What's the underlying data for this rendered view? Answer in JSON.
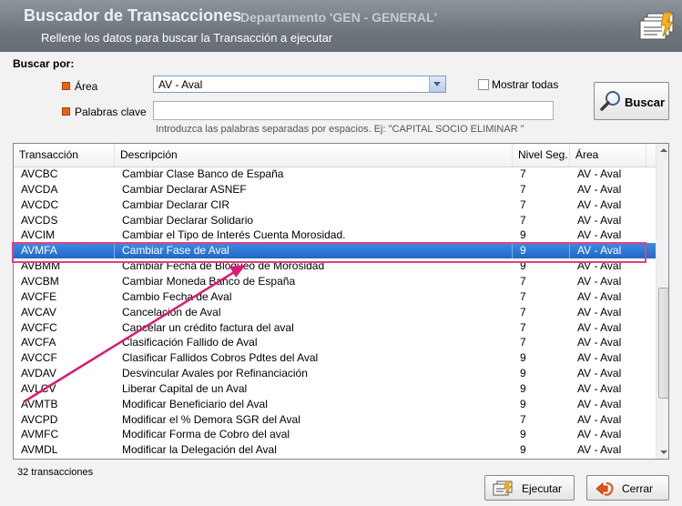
{
  "header": {
    "title": "Buscador de Transacciones",
    "department": "Departamento 'GEN - GENERAL'",
    "subtitle": "Rellene los datos para buscar la Transacción a ejecutar"
  },
  "search": {
    "section_label": "Buscar por:",
    "area_label": "Área",
    "area_value": "AV - Aval",
    "show_all_label": "Mostrar todas",
    "show_all_checked": false,
    "keywords_label": "Palabras clave",
    "keywords_value": "",
    "keywords_hint": "Introduzca las palabras separadas por espacios. Ej: \"CAPITAL SOCIO ELIMINAR \"",
    "search_button": "Buscar"
  },
  "table": {
    "columns": [
      "Transacción",
      "Descripción",
      "Nivel Seg.",
      "Área"
    ],
    "selected_index": 5,
    "rows": [
      [
        "AVCBC",
        "Cambiar Clase Banco de España",
        "7",
        "AV - Aval"
      ],
      [
        "AVCDA",
        "Cambiar Declarar ASNEF",
        "7",
        "AV - Aval"
      ],
      [
        "AVCDC",
        "Cambiar Declarar CIR",
        "7",
        "AV - Aval"
      ],
      [
        "AVCDS",
        "Cambiar Declarar Solidario",
        "7",
        "AV - Aval"
      ],
      [
        "AVCIM",
        "Cambiar el Tipo de Interés Cuenta Morosidad.",
        "9",
        "AV - Aval"
      ],
      [
        "AVMFA",
        "Cambiar Fase de Aval",
        "9",
        "AV - Aval"
      ],
      [
        "AVBMM",
        "Cambiar Fecha de Bloqueo de Morosidad",
        "9",
        "AV - Aval"
      ],
      [
        "AVCBM",
        "Cambiar Moneda Banco de España",
        "7",
        "AV - Aval"
      ],
      [
        "AVCFE",
        "Cambio Fecha de Aval",
        "7",
        "AV - Aval"
      ],
      [
        "AVCAV",
        "Cancelación de Aval",
        "7",
        "AV - Aval"
      ],
      [
        "AVCFC",
        "Cancelar un crédito factura del aval",
        "7",
        "AV - Aval"
      ],
      [
        "AVCFA",
        "Clasificación Fallido de Aval",
        "7",
        "AV - Aval"
      ],
      [
        "AVCCF",
        "Clasificar Fallidos Cobros Pdtes del Aval",
        "9",
        "AV - Aval"
      ],
      [
        "AVDAV",
        "Desvincular Avales por Refinanciación",
        "9",
        "AV - Aval"
      ],
      [
        "AVLCV",
        "Liberar Capital de un Aval",
        "9",
        "AV - Aval"
      ],
      [
        "AVMTB",
        "Modificar Beneficiario del Aval",
        "9",
        "AV - Aval"
      ],
      [
        "AVCPD",
        "Modificar el % Demora SGR del Aval",
        "7",
        "AV - Aval"
      ],
      [
        "AVMFC",
        "Modificar Forma de Cobro del aval",
        "9",
        "AV - Aval"
      ],
      [
        "AVMDL",
        "Modificar la Delegación del Aval",
        "9",
        "AV - Aval"
      ]
    ]
  },
  "footer": {
    "count_text": "32 transacciones",
    "execute_button": "Ejecutar",
    "close_button": "Cerrar"
  },
  "colors": {
    "header_bg": "#6f757c",
    "selected_row": "#2f7ad6",
    "annotation": "#d81b72",
    "bullet": "#e0661b"
  },
  "icons": {
    "header": "card-stack-icon",
    "search": "magnifier-icon",
    "execute": "execute-card-icon",
    "close": "exit-arrow-icon"
  }
}
